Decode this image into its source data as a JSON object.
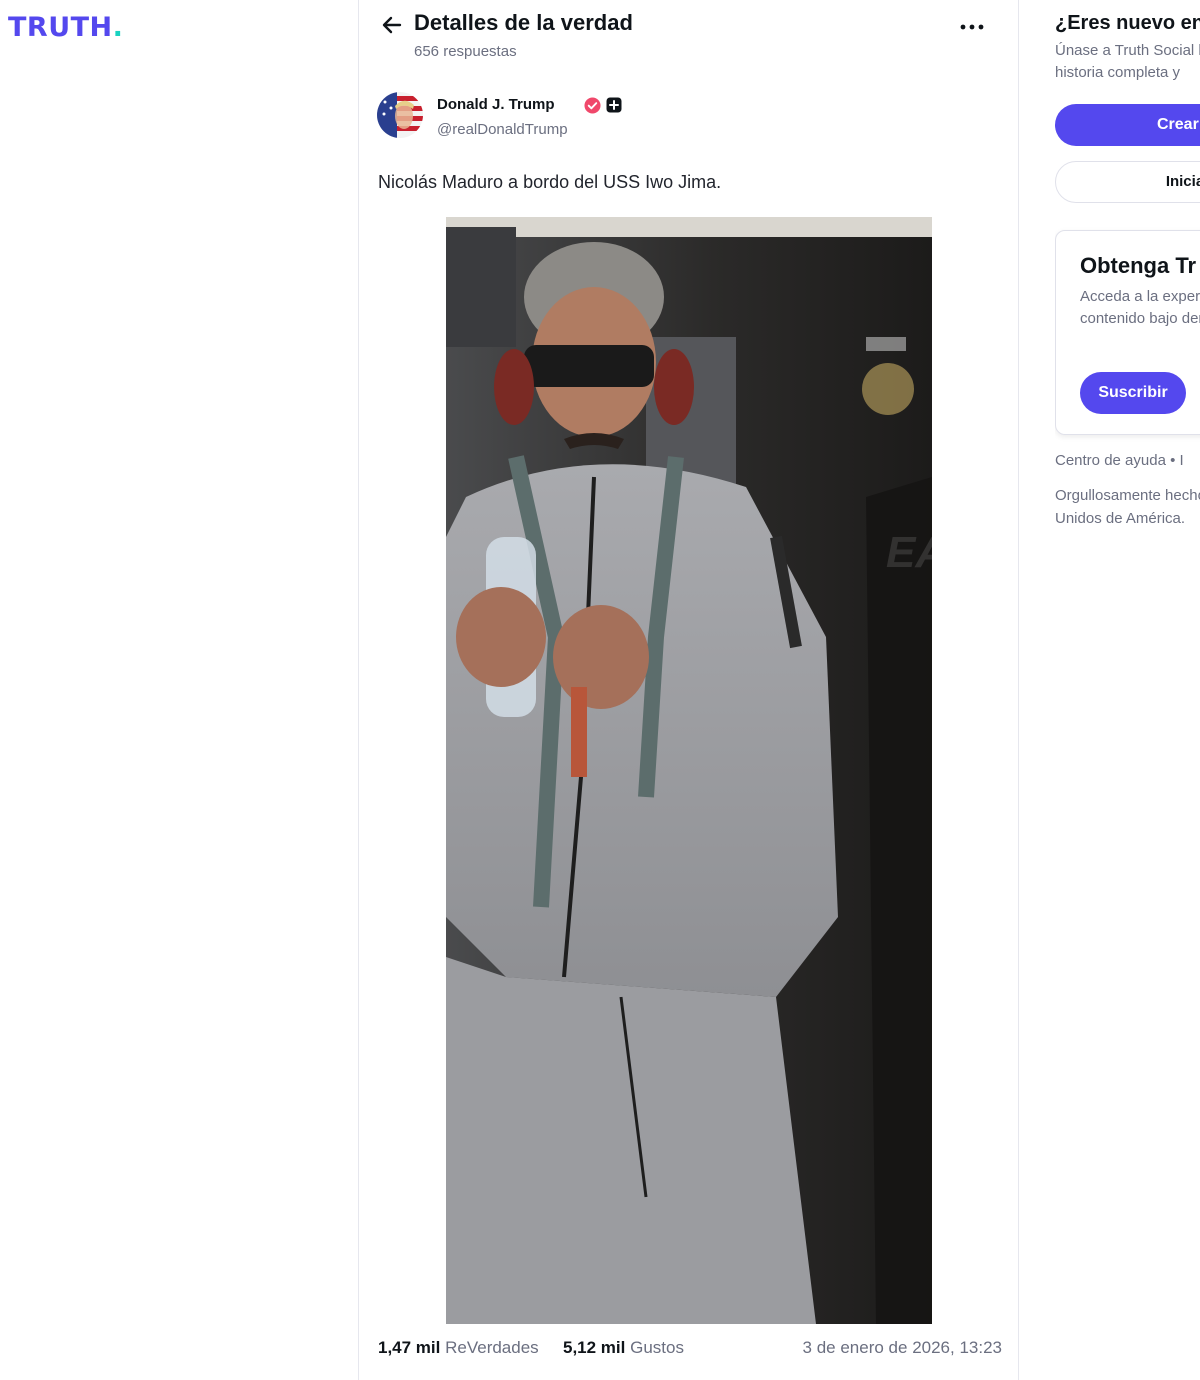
{
  "brand": {
    "logo_text": "TRUTH",
    "logo_dot": ".",
    "color": "#5448ee",
    "dot_color": "#18d2c0"
  },
  "header": {
    "back_icon": "arrow-left-icon",
    "title": "Detalles de la verdad",
    "subtitle": "656 respuestas",
    "more_icon": "more-horizontal-icon"
  },
  "post": {
    "author_name": "Donald J. Trump",
    "author_handle": "@realDonaldTrump",
    "verified_icon": "verified-badge-icon",
    "plus_icon": "plus-badge-icon",
    "text": "Nicolás Maduro a bordo del USS Iwo Jima.",
    "stats": {
      "retruths_count": "1,47 mil",
      "retruths_label": "ReVerdades",
      "likes_count": "5,12 mil",
      "likes_label": "Gustos",
      "date": "3 de enero de 2026, 13:23"
    }
  },
  "sidebar": {
    "title": "¿Eres nuevo en",
    "description": "Únase a Truth Social hoy y obtenga la historia completa y",
    "create_button": "Crear u",
    "login_button": "Inicia",
    "promo": {
      "title": "Obtenga Tr",
      "description": "Acceda a la experiencia con aún más contenido bajo demanda.",
      "subscribe_button": "Suscribir"
    },
    "footer_links": "Centro de ayuda • I",
    "footer_note": "Orgullosamente hecho en los Estados Unidos de América."
  },
  "colors": {
    "accent": "#5448ee",
    "verified": "#f0486b",
    "muted": "#6b6f80"
  }
}
